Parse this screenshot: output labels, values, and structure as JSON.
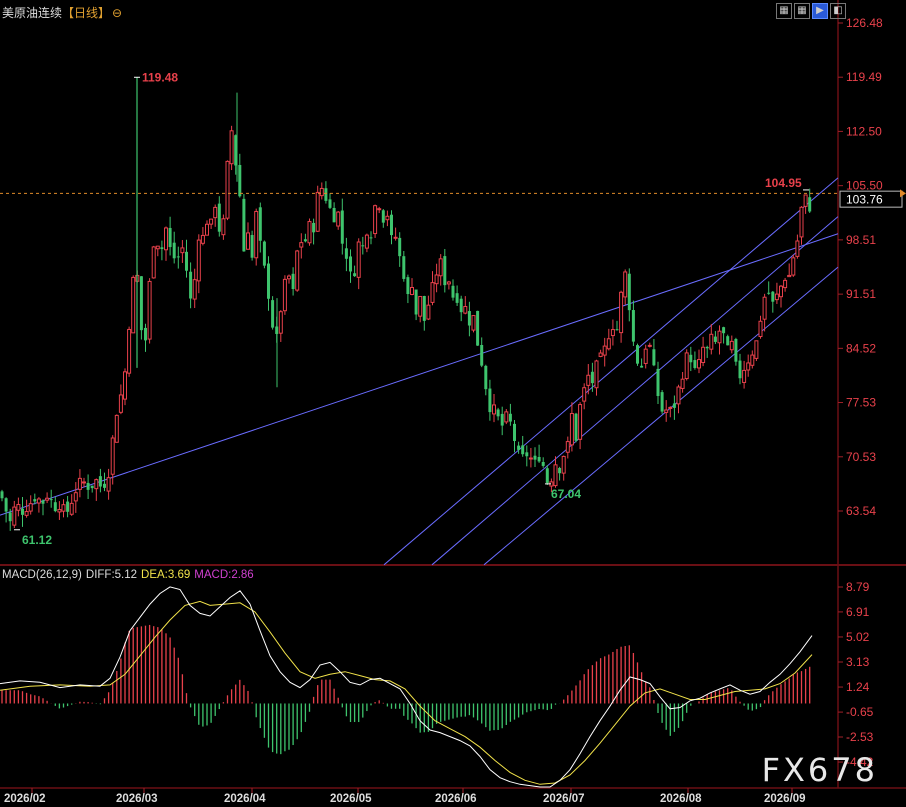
{
  "header": {
    "instrument": "美原油连续",
    "period": "【日线】",
    "settings_icon": "gear-circle-icon"
  },
  "toolbar": [
    {
      "icon": "grid-icon",
      "active": false
    },
    {
      "icon": "grid-icon",
      "active": false
    },
    {
      "icon": "play-icon",
      "active": true
    },
    {
      "icon": "split-icon",
      "active": false
    }
  ],
  "watermark": "FX678",
  "price_label": "103.76",
  "macd_header": {
    "title": "MACD(26,12,9)",
    "diff": "DIFF:5.12",
    "dea": "DEA:3.69",
    "macd": "MACD:2.86"
  },
  "colors": {
    "up": "#e8414b",
    "down": "#3ec46d",
    "channel": "#6a6cff",
    "diff_line": "#ffffff",
    "dea_line": "#f1e24a",
    "macd_text": "#d040d0",
    "axis_text": "#e8414b",
    "price_line": "#e08a2a"
  },
  "chart_data": [
    {
      "type": "candlestick",
      "title": "美原油连续【日线】",
      "y_ticks": [
        "126.48",
        "119.49",
        "112.50",
        "105.50",
        "98.51",
        "91.51",
        "84.52",
        "77.53",
        "70.53",
        "63.54"
      ],
      "ylim": [
        56.6,
        126.48
      ],
      "x_ticks": [
        "2026/02",
        "2026/03",
        "2026/04",
        "2026/05",
        "2026/06",
        "2026/07",
        "2026/08",
        "2026/09"
      ],
      "last_price": 103.76,
      "annotations": [
        {
          "text": "119.48",
          "value": 119.48,
          "kind": "high"
        },
        {
          "text": "61.12",
          "value": 61.12,
          "kind": "low"
        },
        {
          "text": "67.04",
          "value": 67.04,
          "kind": "low"
        },
        {
          "text": "104.95",
          "value": 104.95,
          "kind": "high"
        }
      ],
      "close_path": [
        [
          0,
          66
        ],
        [
          5,
          64
        ],
        [
          10,
          62
        ],
        [
          16,
          64.5
        ],
        [
          22,
          63.5
        ],
        [
          30,
          64.5
        ],
        [
          36,
          65.5
        ],
        [
          42,
          64.5
        ],
        [
          48,
          65.8
        ],
        [
          54,
          64
        ],
        [
          60,
          64.5
        ],
        [
          66,
          63
        ],
        [
          72,
          65
        ],
        [
          78,
          67
        ],
        [
          84,
          67.2
        ],
        [
          90,
          66.5
        ],
        [
          96,
          67.5
        ],
        [
          102,
          66.5
        ],
        [
          108,
          68
        ],
        [
          112,
          72
        ],
        [
          116,
          76
        ],
        [
          120,
          78
        ],
        [
          124,
          80
        ],
        [
          128,
          86
        ],
        [
          132,
          92
        ],
        [
          136,
          96
        ],
        [
          140,
          89
        ],
        [
          144,
          83
        ],
        [
          148,
          90
        ],
        [
          152,
          97
        ],
        [
          156,
          100
        ],
        [
          160,
          96
        ],
        [
          164,
          99
        ],
        [
          168,
          101
        ],
        [
          172,
          94
        ],
        [
          176,
          98
        ],
        [
          180,
          95
        ],
        [
          184,
          99
        ],
        [
          188,
          92
        ],
        [
          192,
          90
        ],
        [
          196,
          95
        ],
        [
          200,
          101
        ],
        [
          204,
          98
        ],
        [
          208,
          102
        ],
        [
          212,
          100
        ],
        [
          216,
          104
        ],
        [
          220,
          99
        ],
        [
          224,
          101
        ],
        [
          228,
          109
        ],
        [
          232,
          113
        ],
        [
          236,
          108
        ],
        [
          240,
          104
        ],
        [
          244,
          97
        ],
        [
          248,
          100
        ],
        [
          252,
          96
        ],
        [
          256,
          102
        ],
        [
          260,
          98
        ],
        [
          264,
          95
        ],
        [
          268,
          92
        ],
        [
          272,
          88
        ],
        [
          276,
          85
        ],
        [
          280,
          89
        ],
        [
          284,
          92
        ],
        [
          288,
          95
        ],
        [
          292,
          90
        ],
        [
          296,
          96
        ],
        [
          300,
          99
        ],
        [
          304,
          97
        ],
        [
          308,
          101
        ],
        [
          312,
          99
        ],
        [
          316,
          102
        ],
        [
          320,
          107
        ],
        [
          324,
          103
        ],
        [
          328,
          105
        ],
        [
          332,
          100
        ],
        [
          336,
          103
        ],
        [
          340,
          101
        ],
        [
          344,
          96
        ],
        [
          348,
          97
        ],
        [
          352,
          92
        ],
        [
          356,
          96
        ],
        [
          360,
          99
        ],
        [
          364,
          97
        ],
        [
          368,
          101
        ],
        [
          372,
          99
        ],
        [
          376,
          104
        ],
        [
          380,
          103
        ],
        [
          384,
          101
        ],
        [
          388,
          102
        ],
        [
          392,
          98
        ],
        [
          396,
          99
        ],
        [
          400,
          96
        ],
        [
          404,
          94
        ],
        [
          408,
          91
        ],
        [
          412,
          93
        ],
        [
          416,
          89
        ],
        [
          420,
          91
        ],
        [
          424,
          88
        ],
        [
          428,
          90
        ],
        [
          432,
          92
        ],
        [
          436,
          94
        ],
        [
          440,
          96
        ],
        [
          444,
          93
        ],
        [
          448,
          94
        ],
        [
          452,
          91
        ],
        [
          456,
          92
        ],
        [
          460,
          89
        ],
        [
          464,
          91
        ],
        [
          468,
          87
        ],
        [
          472,
          90
        ],
        [
          476,
          86
        ],
        [
          480,
          84
        ],
        [
          484,
          81
        ],
        [
          488,
          78
        ],
        [
          492,
          76
        ],
        [
          496,
          77
        ],
        [
          500,
          74
        ],
        [
          504,
          75
        ],
        [
          508,
          76
        ],
        [
          512,
          74
        ],
        [
          516,
          72
        ],
        [
          520,
          70
        ],
        [
          524,
          70.5
        ],
        [
          528,
          71
        ],
        [
          532,
          70
        ],
        [
          536,
          69.5
        ],
        [
          540,
          71
        ],
        [
          544,
          69
        ],
        [
          548,
          67.04
        ],
        [
          552,
          68
        ],
        [
          556,
          70
        ],
        [
          560,
          69
        ],
        [
          564,
          71
        ],
        [
          568,
          72
        ],
        [
          572,
          76
        ],
        [
          576,
          73
        ],
        [
          580,
          77
        ],
        [
          584,
          79
        ],
        [
          588,
          81
        ],
        [
          592,
          80
        ],
        [
          596,
          82
        ],
        [
          600,
          83
        ],
        [
          604,
          84
        ],
        [
          608,
          86
        ],
        [
          612,
          88
        ],
        [
          616,
          86
        ],
        [
          620,
          90
        ],
        [
          624,
          95
        ],
        [
          628,
          92
        ],
        [
          632,
          86
        ],
        [
          636,
          84
        ],
        [
          640,
          81
        ],
        [
          644,
          84
        ],
        [
          648,
          86
        ],
        [
          652,
          83
        ],
        [
          656,
          80
        ],
        [
          660,
          77
        ],
        [
          664,
          76
        ],
        [
          668,
          77
        ],
        [
          672,
          76
        ],
        [
          676,
          78
        ],
        [
          680,
          80
        ],
        [
          684,
          82
        ],
        [
          688,
          84
        ],
        [
          692,
          83
        ],
        [
          696,
          81
        ],
        [
          700,
          83
        ],
        [
          704,
          85
        ],
        [
          708,
          84
        ],
        [
          712,
          86
        ],
        [
          716,
          85
        ],
        [
          720,
          87
        ],
        [
          724,
          86
        ],
        [
          728,
          84
        ],
        [
          732,
          85
        ],
        [
          736,
          82
        ],
        [
          740,
          81
        ],
        [
          744,
          82
        ],
        [
          748,
          83
        ],
        [
          752,
          84
        ],
        [
          756,
          85
        ],
        [
          760,
          88
        ],
        [
          764,
          91
        ],
        [
          768,
          92
        ],
        [
          772,
          90
        ],
        [
          776,
          91
        ],
        [
          780,
          92
        ],
        [
          784,
          94
        ],
        [
          788,
          93
        ],
        [
          792,
          96
        ],
        [
          796,
          97
        ],
        [
          800,
          101
        ],
        [
          804,
          104.95
        ],
        [
          808,
          102
        ],
        [
          812,
          103.76
        ]
      ]
    },
    {
      "type": "line",
      "title": "MACD(26,12,9)",
      "y_ticks": [
        "8.79",
        "6.91",
        "5.02",
        "3.13",
        "1.24",
        "-0.65",
        "-2.53",
        "-4.42"
      ],
      "ylim": [
        -6.3,
        8.79
      ],
      "series": [
        {
          "name": "DIFF",
          "value": 5.12
        },
        {
          "name": "DEA",
          "value": 3.69
        },
        {
          "name": "MACD",
          "value": 2.86
        }
      ],
      "diff_path": [
        [
          0,
          1.5
        ],
        [
          20,
          1.7
        ],
        [
          40,
          1.6
        ],
        [
          60,
          1.2
        ],
        [
          80,
          1.4
        ],
        [
          100,
          1.3
        ],
        [
          110,
          1.9
        ],
        [
          120,
          3.5
        ],
        [
          130,
          5.5
        ],
        [
          140,
          6.5
        ],
        [
          150,
          7.5
        ],
        [
          160,
          8.3
        ],
        [
          170,
          8.8
        ],
        [
          180,
          8.6
        ],
        [
          190,
          7.4
        ],
        [
          200,
          6.8
        ],
        [
          210,
          6.6
        ],
        [
          220,
          7.3
        ],
        [
          230,
          8.0
        ],
        [
          240,
          8.5
        ],
        [
          250,
          7.5
        ],
        [
          260,
          5.5
        ],
        [
          270,
          3.6
        ],
        [
          280,
          2.4
        ],
        [
          290,
          1.6
        ],
        [
          300,
          1.2
        ],
        [
          310,
          1.8
        ],
        [
          320,
          2.9
        ],
        [
          330,
          3.1
        ],
        [
          340,
          2.4
        ],
        [
          350,
          1.6
        ],
        [
          360,
          1.4
        ],
        [
          370,
          1.8
        ],
        [
          380,
          1.9
        ],
        [
          390,
          1.5
        ],
        [
          400,
          1.1
        ],
        [
          410,
          0.0
        ],
        [
          420,
          -1.3
        ],
        [
          430,
          -2.0
        ],
        [
          440,
          -2.2
        ],
        [
          450,
          -2.5
        ],
        [
          460,
          -2.8
        ],
        [
          470,
          -3.2
        ],
        [
          480,
          -4.0
        ],
        [
          490,
          -5.0
        ],
        [
          500,
          -5.6
        ],
        [
          510,
          -5.9
        ],
        [
          520,
          -6.1
        ],
        [
          530,
          -6.2
        ],
        [
          540,
          -6.3
        ],
        [
          550,
          -6.3
        ],
        [
          560,
          -5.8
        ],
        [
          570,
          -5.0
        ],
        [
          580,
          -3.8
        ],
        [
          590,
          -2.5
        ],
        [
          600,
          -1.3
        ],
        [
          610,
          -0.2
        ],
        [
          620,
          1.0
        ],
        [
          630,
          2.0
        ],
        [
          640,
          1.8
        ],
        [
          650,
          1.5
        ],
        [
          660,
          0.5
        ],
        [
          670,
          -0.4
        ],
        [
          680,
          -0.3
        ],
        [
          690,
          0.2
        ],
        [
          700,
          0.4
        ],
        [
          710,
          0.8
        ],
        [
          720,
          1.1
        ],
        [
          730,
          1.4
        ],
        [
          740,
          1.0
        ],
        [
          750,
          0.7
        ],
        [
          760,
          0.9
        ],
        [
          770,
          1.6
        ],
        [
          780,
          2.2
        ],
        [
          790,
          3.0
        ],
        [
          800,
          3.9
        ],
        [
          812,
          5.12
        ]
      ],
      "dea_path": [
        [
          0,
          1.0
        ],
        [
          30,
          1.3
        ],
        [
          60,
          1.4
        ],
        [
          90,
          1.3
        ],
        [
          110,
          1.4
        ],
        [
          125,
          2.2
        ],
        [
          140,
          3.6
        ],
        [
          155,
          5.0
        ],
        [
          170,
          6.3
        ],
        [
          185,
          7.4
        ],
        [
          200,
          7.7
        ],
        [
          210,
          7.4
        ],
        [
          225,
          7.5
        ],
        [
          240,
          7.6
        ],
        [
          255,
          6.9
        ],
        [
          270,
          5.4
        ],
        [
          285,
          3.8
        ],
        [
          300,
          2.4
        ],
        [
          315,
          1.9
        ],
        [
          330,
          2.2
        ],
        [
          345,
          2.4
        ],
        [
          360,
          2.1
        ],
        [
          375,
          1.8
        ],
        [
          390,
          1.7
        ],
        [
          405,
          1.1
        ],
        [
          420,
          -0.2
        ],
        [
          435,
          -1.3
        ],
        [
          450,
          -1.9
        ],
        [
          465,
          -2.5
        ],
        [
          480,
          -3.3
        ],
        [
          495,
          -4.3
        ],
        [
          510,
          -5.2
        ],
        [
          525,
          -5.8
        ],
        [
          540,
          -6.1
        ],
        [
          555,
          -6.0
        ],
        [
          570,
          -5.4
        ],
        [
          585,
          -4.3
        ],
        [
          600,
          -3.0
        ],
        [
          615,
          -1.6
        ],
        [
          630,
          -0.2
        ],
        [
          645,
          0.8
        ],
        [
          660,
          1.1
        ],
        [
          675,
          0.7
        ],
        [
          690,
          0.3
        ],
        [
          705,
          0.3
        ],
        [
          720,
          0.6
        ],
        [
          735,
          0.9
        ],
        [
          750,
          1.0
        ],
        [
          765,
          1.1
        ],
        [
          780,
          1.5
        ],
        [
          795,
          2.3
        ],
        [
          812,
          3.69
        ]
      ]
    }
  ]
}
